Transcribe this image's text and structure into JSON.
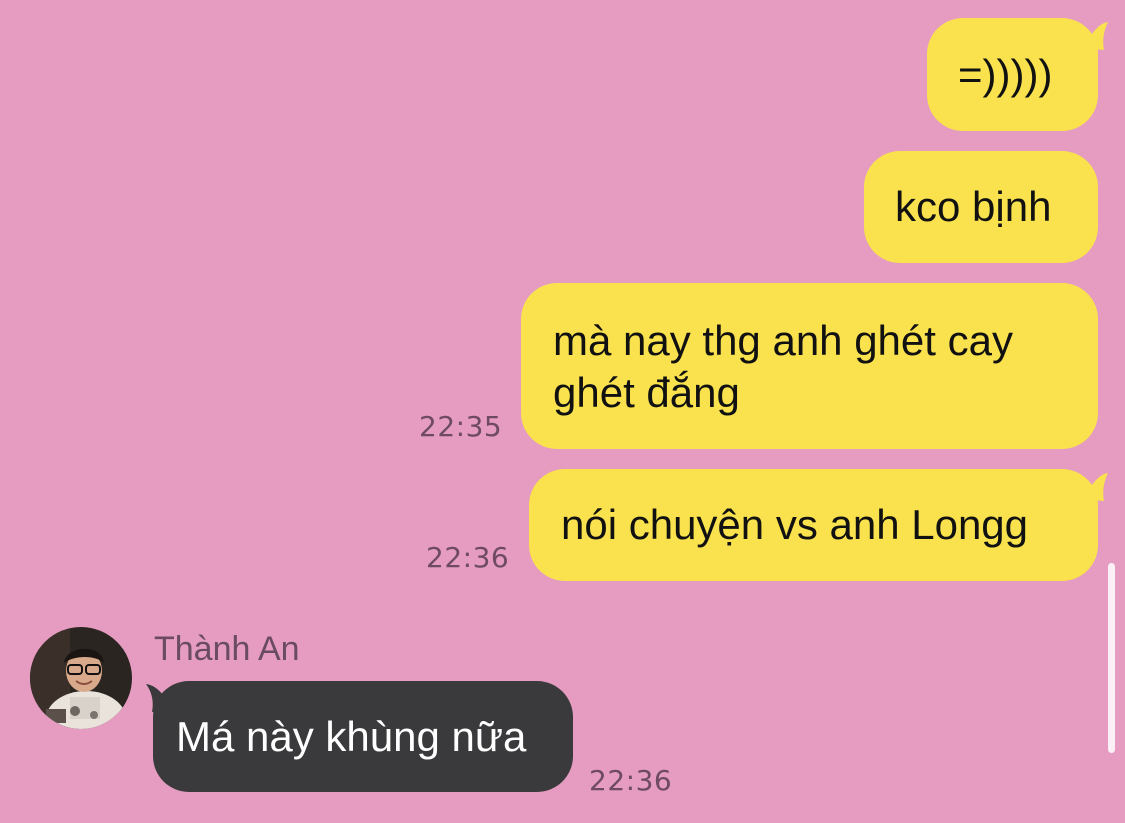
{
  "messages": {
    "m1": {
      "text": "=)))))"
    },
    "m2": {
      "text": "kco bịnh"
    },
    "m3": {
      "text_line1": "mà nay thg anh ghét cay",
      "text_line2": "ghét đắng",
      "time": "22:35"
    },
    "m4": {
      "text": "nói chuyện vs anh Longg",
      "time": "22:36"
    },
    "m5": {
      "sender": "Thành An",
      "text": "Má này khùng nữa",
      "time": "22:36"
    }
  },
  "colors": {
    "background": "#e59cc0",
    "outgoing_bubble": "#f9e24d",
    "incoming_bubble": "#3a3a3c",
    "timestamp": "#6f4a63"
  }
}
